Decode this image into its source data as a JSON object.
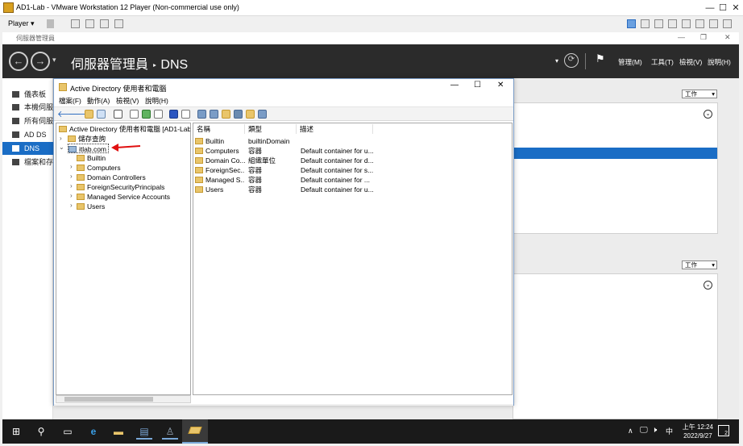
{
  "vmware": {
    "title": "AD1-Lab - VMware Workstation 12 Player (Non-commercial use only)",
    "player_label": "Player",
    "min": "—",
    "max": "☐",
    "close": "✕"
  },
  "server_manager": {
    "top_title": "伺服器管理員",
    "breadcrumb_root": "伺服器管理員",
    "breadcrumb_sep": "‣",
    "breadcrumb_page": "DNS",
    "menu": [
      "管理(M)",
      "工具(T)",
      "檢視(V)",
      "說明(H)"
    ],
    "nav": [
      "儀表板",
      "本機伺服",
      "所有伺服",
      "AD DS",
      "DNS",
      "檔案和存"
    ],
    "tasks_label": "工作",
    "tasks_label2": "工作"
  },
  "aduc": {
    "title": "Active Directory 使用者和電腦",
    "menu": [
      "檔案(F)",
      "動作(A)",
      "檢視(V)",
      "說明(H)"
    ],
    "tree": {
      "root": "Active Directory 使用者和電腦 [AD1-Lab.itl",
      "saved": "儲存查詢",
      "domain": "itlab.com",
      "children": [
        "Builtin",
        "Computers",
        "Domain Controllers",
        "ForeignSecurityPrincipals",
        "Managed Service Accounts",
        "Users"
      ]
    },
    "list": {
      "headers": [
        "名稱",
        "類型",
        "描述"
      ],
      "rows": [
        {
          "name": "Builtin",
          "type": "builtinDomain",
          "desc": ""
        },
        {
          "name": "Computers",
          "type": "容器",
          "desc": "Default container for u..."
        },
        {
          "name": "Domain Co...",
          "type": "組織單位",
          "desc": "Default container for d..."
        },
        {
          "name": "ForeignSec...",
          "type": "容器",
          "desc": "Default container for s..."
        },
        {
          "name": "Managed S...",
          "type": "容器",
          "desc": "Default container for ..."
        },
        {
          "name": "Users",
          "type": "容器",
          "desc": "Default container for u..."
        }
      ]
    }
  },
  "taskbar": {
    "time": "上午 12:24",
    "date": "2022/9/27",
    "ime": "中",
    "notif_count": "2"
  }
}
